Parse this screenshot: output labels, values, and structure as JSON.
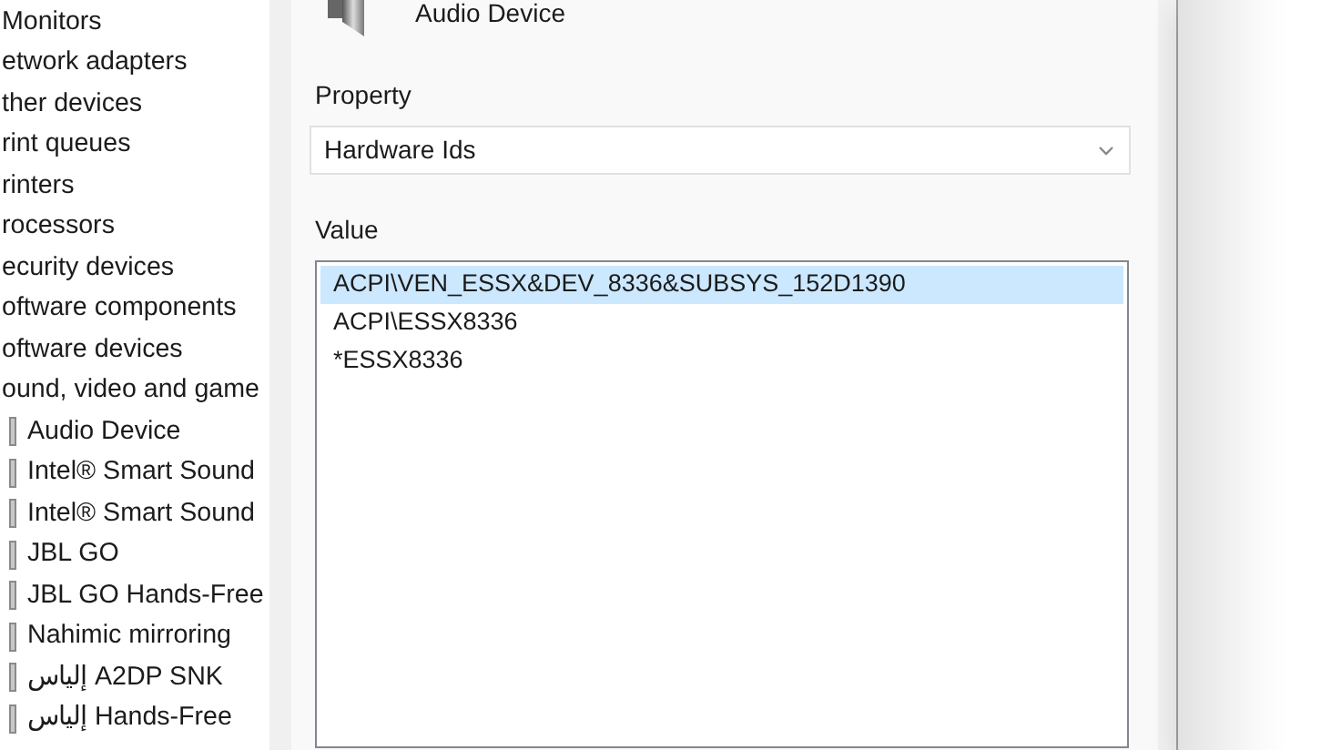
{
  "device_tree": {
    "items": [
      {
        "label": "Monitors"
      },
      {
        "label": "etwork adapters"
      },
      {
        "label": "ther devices"
      },
      {
        "label": "rint queues"
      },
      {
        "label": "rinters"
      },
      {
        "label": "rocessors"
      },
      {
        "label": "ecurity devices"
      },
      {
        "label": "oftware components"
      },
      {
        "label": "oftware devices"
      },
      {
        "label": "ound, video and game",
        "children": [
          {
            "label": "Audio Device"
          },
          {
            "label": "Intel® Smart Sound"
          },
          {
            "label": "Intel® Smart Sound"
          },
          {
            "label": "JBL GO"
          },
          {
            "label": "JBL GO Hands-Free"
          },
          {
            "label": "Nahimic mirroring"
          },
          {
            "label": "إلياس  A2DP SNK"
          },
          {
            "label": "إلياس  Hands-Free"
          }
        ]
      }
    ]
  },
  "dialog": {
    "device_name": "Audio Device",
    "property": {
      "label": "Property",
      "value": "Hardware Ids"
    },
    "value": {
      "label": "Value",
      "rows": [
        {
          "text": "ACPI\\VEN_ESSX&DEV_8336&SUBSYS_152D1390",
          "selected": true
        },
        {
          "text": "ACPI\\ESSX8336",
          "selected": false
        },
        {
          "text": "*ESSX8336",
          "selected": false
        }
      ]
    }
  }
}
